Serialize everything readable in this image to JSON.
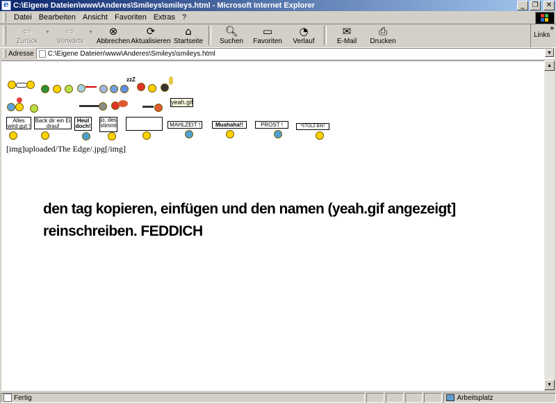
{
  "window": {
    "title": "C:\\Eigene Dateien\\www\\Anderes\\Smileys\\smileys.html - Microsoft Internet Explorer"
  },
  "menu": [
    "Datei",
    "Bearbeiten",
    "Ansicht",
    "Favoriten",
    "Extras",
    "?"
  ],
  "toolbar": {
    "back": "Zurück",
    "forward": "Vorwärts",
    "stop": "Abbrechen",
    "refresh": "Aktualisieren",
    "home": "Startseite",
    "search": "Suchen",
    "favorites": "Favoriten",
    "history": "Verlauf",
    "mail": "E-Mail",
    "print": "Drucken",
    "links": "Links"
  },
  "address": {
    "label": "Adresse",
    "url": "C:\\Eigene Dateien\\www\\Anderes\\Smileys\\smileys.html"
  },
  "content": {
    "signs": [
      "Alles wird gut !",
      "Back dir ein Ei drauf",
      "Heul doch!",
      "jo, des stimmt",
      "MAHLZEIT !",
      "Muahaha!!",
      "PROST !",
      "*STOLZ BIN*"
    ],
    "tooltip": "yeah.gif",
    "img_text": "[img]uploaded/The Edge/.jpg[/img]",
    "instruction_line1": "den tag kopieren, einfügen und den namen (yeah.gif angezeigt]",
    "instruction_line2": "reinschreiben. FEDDICH"
  },
  "status": {
    "left": "Fertig",
    "zone": "Arbeitsplatz"
  }
}
